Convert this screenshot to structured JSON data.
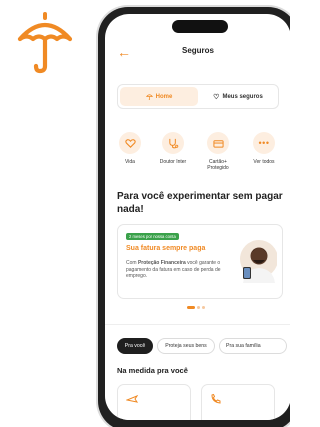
{
  "colors": {
    "accent": "#f08a24",
    "accent_light": "#fdeee0",
    "badge_green": "#3aa14a",
    "dark": "#1f1f1f"
  },
  "header": {
    "title": "Seguros",
    "back_icon": "arrow-left-icon"
  },
  "tabs": [
    {
      "label": "Home",
      "icon": "umbrella-icon",
      "active": true
    },
    {
      "label": "Meus seguros",
      "icon": "heart-icon",
      "active": false
    }
  ],
  "quick_actions": [
    {
      "label": "Vida",
      "icon": "heart-icon"
    },
    {
      "label": "Doutor Inter",
      "icon": "stethoscope-icon"
    },
    {
      "label": "Cartão+ Protegido",
      "icon": "card-icon"
    },
    {
      "label": "Ver todos",
      "icon": "more-icon"
    }
  ],
  "hero": {
    "text": "Para você experimentar sem pagar nada!"
  },
  "promo": {
    "badge": "2 meses por nossa conta",
    "heading": "Sua fatura sempre paga",
    "body_prefix": "Com ",
    "body_bold": "Proteção Financeira",
    "body_suffix": " você garante o pagamento da fatura em caso de perda de emprego."
  },
  "carousel": {
    "pages": 3,
    "current": 1
  },
  "chips": [
    {
      "label": "Pra você",
      "active": true
    },
    {
      "label": "Proteja seus bens",
      "active": false
    },
    {
      "label": "Pra sua família",
      "active": false
    }
  ],
  "section": {
    "title": "Na medida pra você"
  }
}
